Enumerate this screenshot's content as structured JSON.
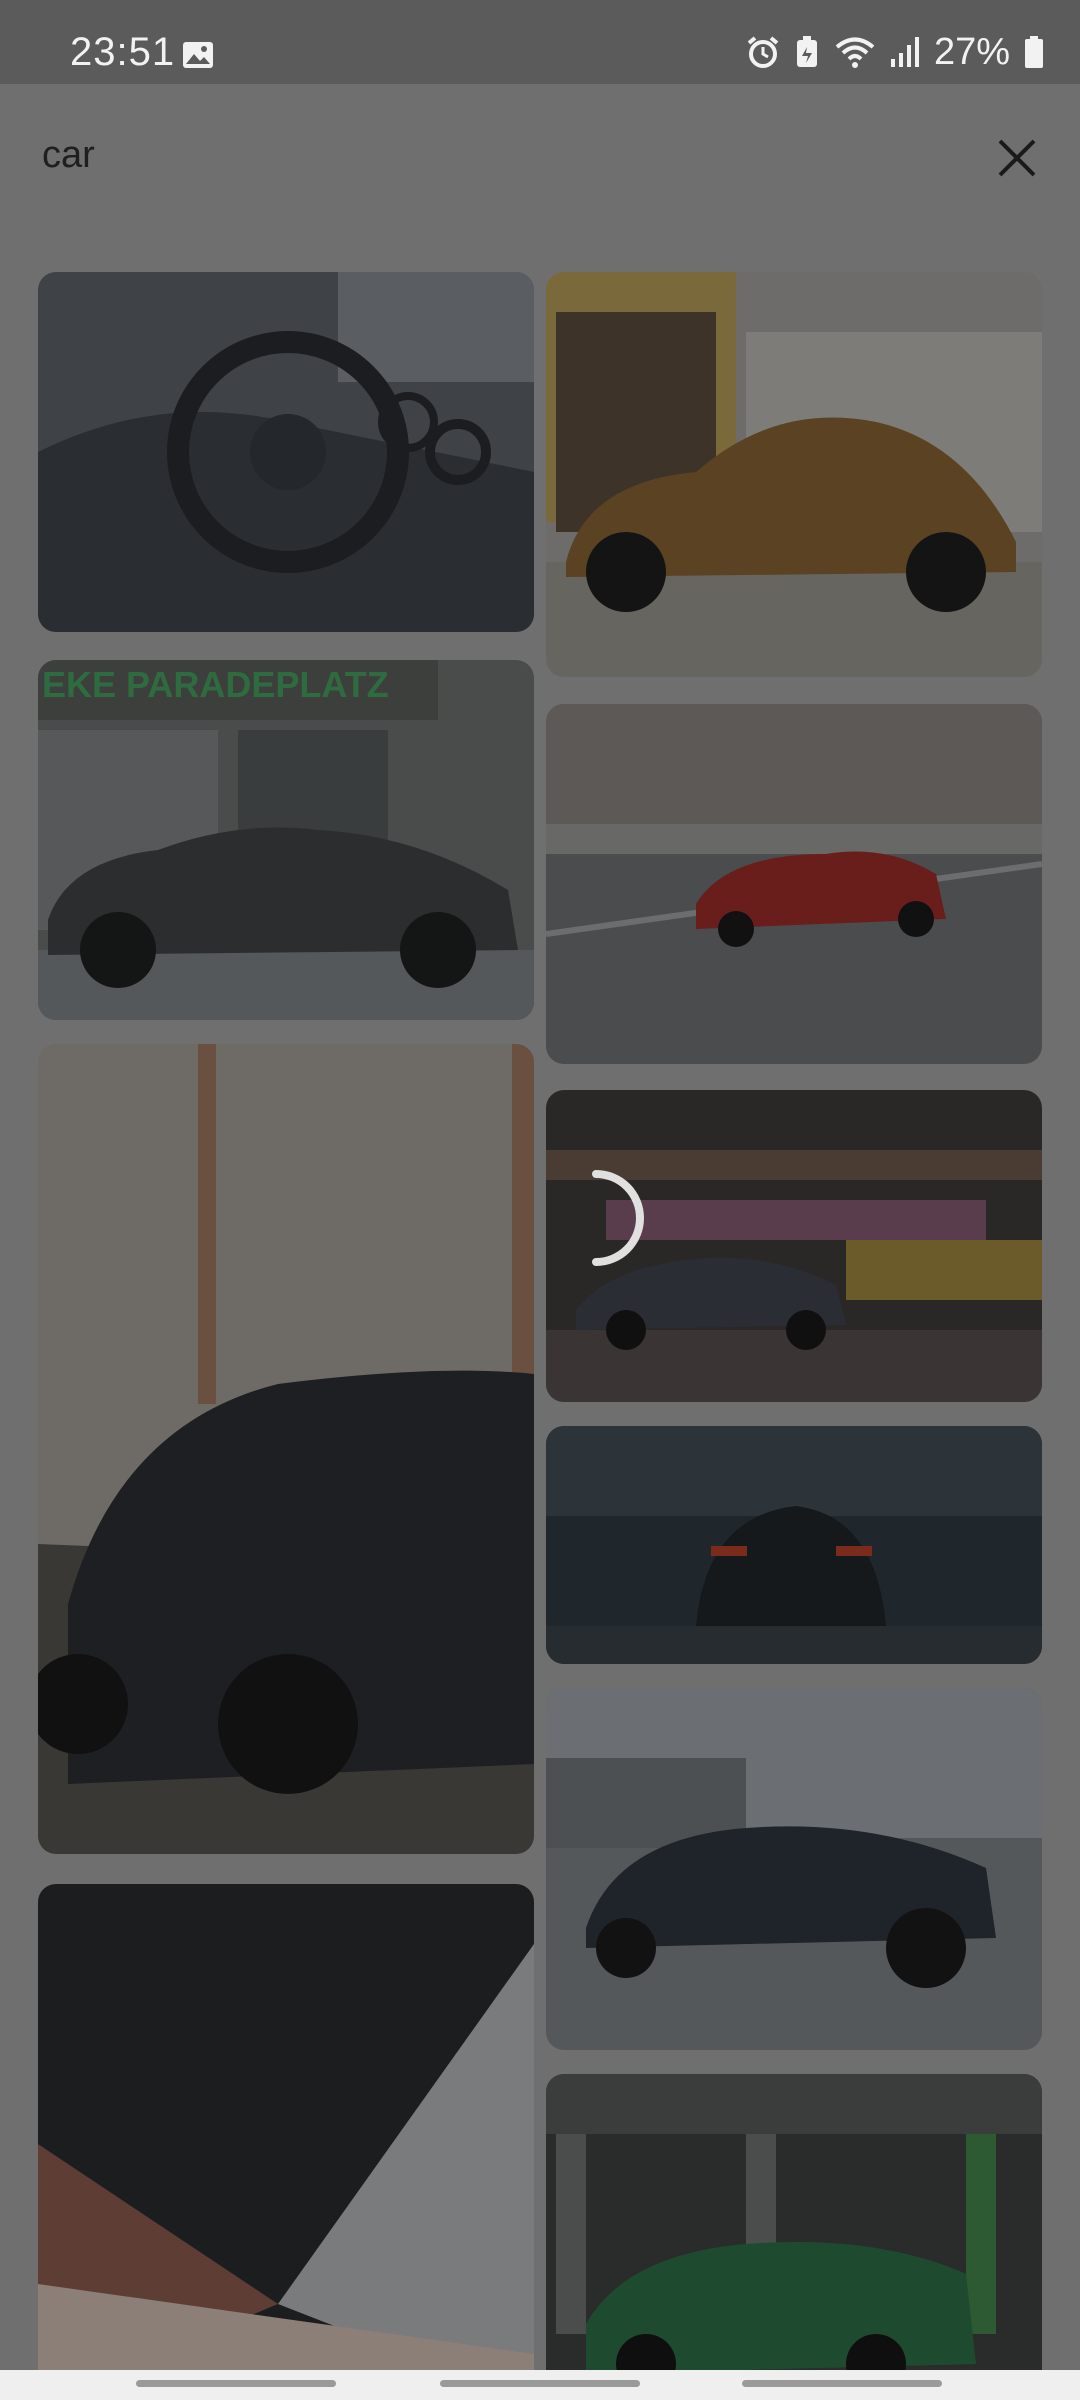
{
  "status_bar": {
    "time": "23:51",
    "battery_percent": "27%",
    "icons": [
      "image-icon",
      "alarm-icon",
      "battery-saver-icon",
      "wifi-icon",
      "signal-icon",
      "battery-icon"
    ]
  },
  "search": {
    "query": "car",
    "close_icon": "close-icon"
  },
  "results": [
    {
      "column": "left",
      "subject": "steering-wheel-interior"
    },
    {
      "column": "left",
      "subject": "grey-sports-car-storefront",
      "sign_text": "EKE PARADEPLATZ"
    },
    {
      "column": "left",
      "subject": "black-sedan-sunset"
    },
    {
      "column": "left",
      "subject": "tunnel-motion-blur"
    },
    {
      "column": "right",
      "subject": "vintage-beetle"
    },
    {
      "column": "right",
      "subject": "red-coupe-road"
    },
    {
      "column": "right",
      "subject": "dark-coupe-motion-blur"
    },
    {
      "column": "right",
      "subject": "car-night-taillights"
    },
    {
      "column": "right",
      "subject": "dark-blue-sedan-parking"
    },
    {
      "column": "right",
      "subject": "green-car-garage"
    }
  ],
  "loading": true,
  "colors": {
    "overlay": "#6f6f6f",
    "status_bar": "#5b5b5b"
  }
}
